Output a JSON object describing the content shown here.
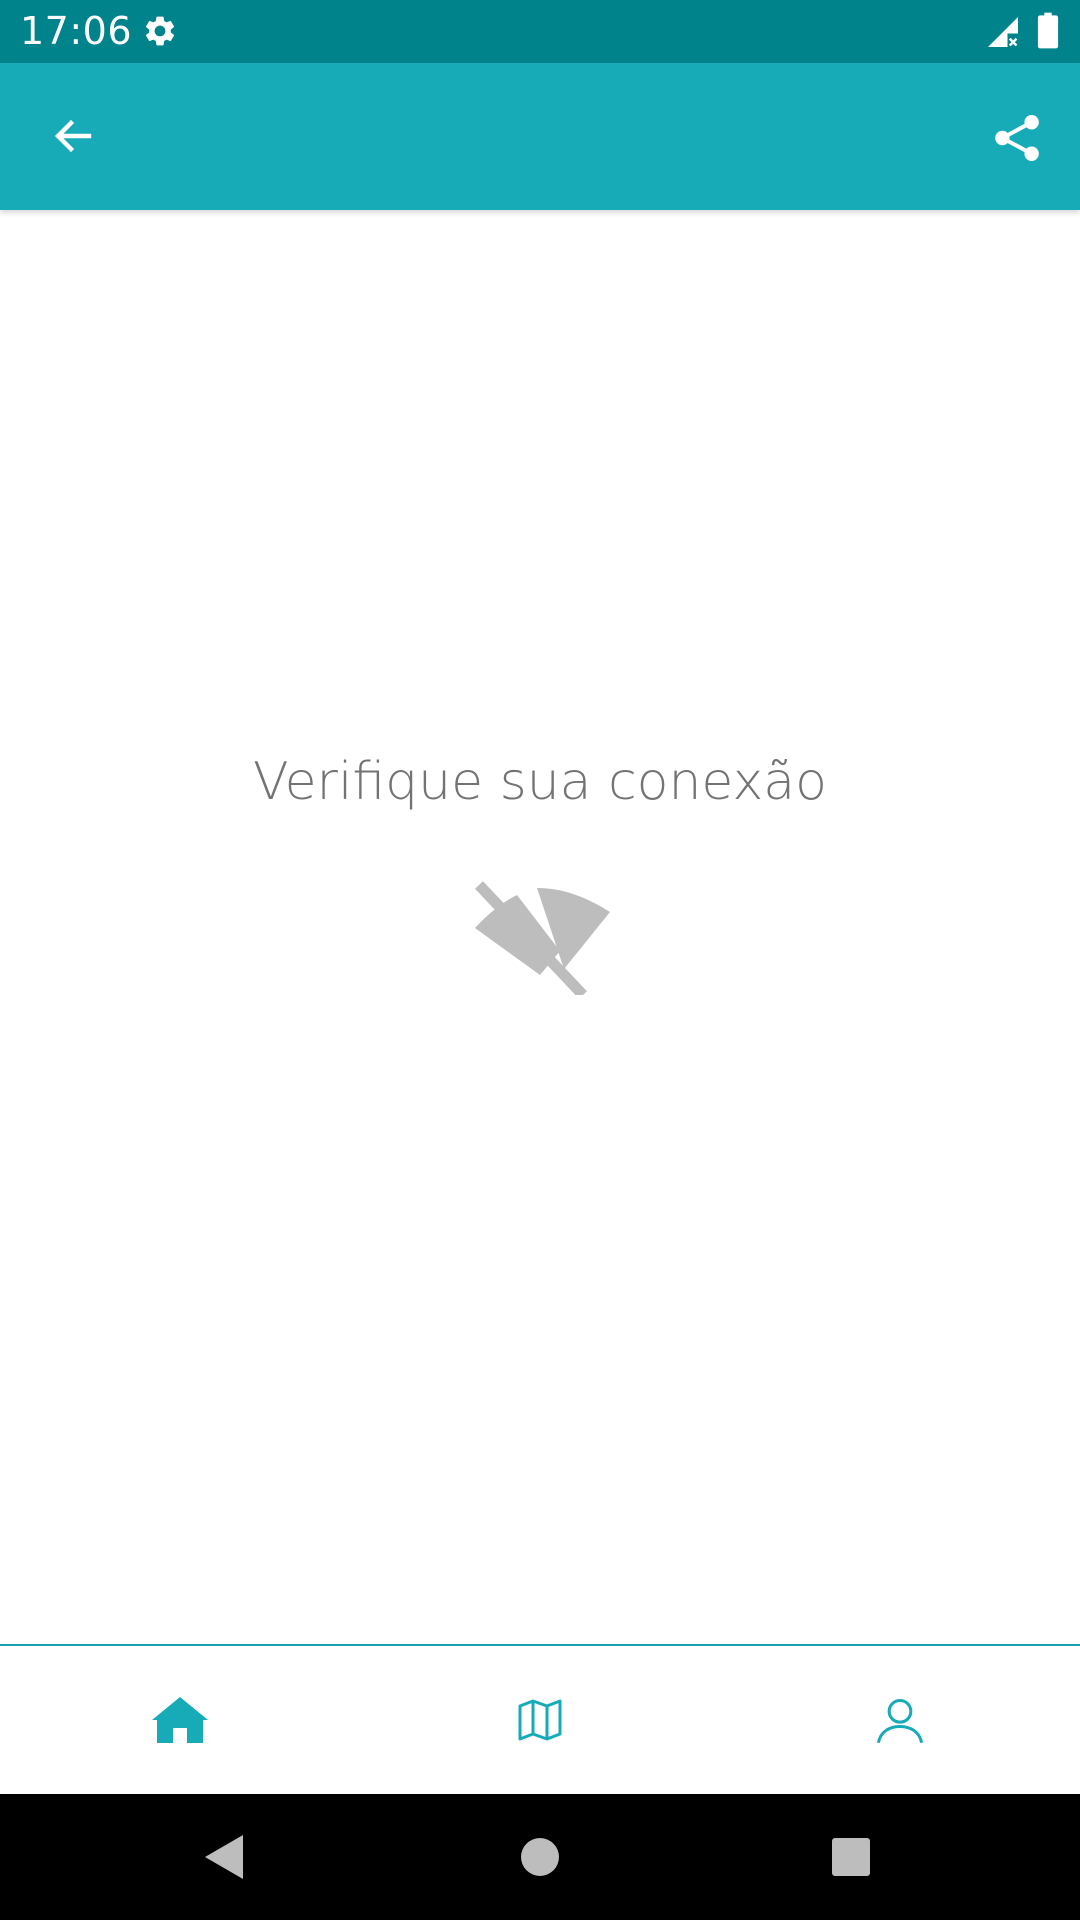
{
  "status_bar": {
    "time": "17:06",
    "icons": [
      "settings-gear-icon",
      "signal-no-data-icon",
      "battery-full-icon"
    ]
  },
  "app_bar": {
    "back_icon": "arrow-left-icon",
    "share_icon": "share-icon"
  },
  "content": {
    "message": "Verifique sua conexão",
    "icon": "wifi-off-icon"
  },
  "bottom_nav": {
    "items": [
      {
        "icon": "home-icon",
        "active": true
      },
      {
        "icon": "map-icon",
        "active": false
      },
      {
        "icon": "person-icon",
        "active": false
      }
    ]
  },
  "system_nav": {
    "icons": [
      "back-triangle-icon",
      "home-circle-icon",
      "recents-square-icon"
    ]
  },
  "colors": {
    "status_bar": "#00838a",
    "app_bar": "#17abb8",
    "accent": "#17abb8",
    "message_text": "#737373",
    "icon_gray": "#bdbdbd"
  }
}
